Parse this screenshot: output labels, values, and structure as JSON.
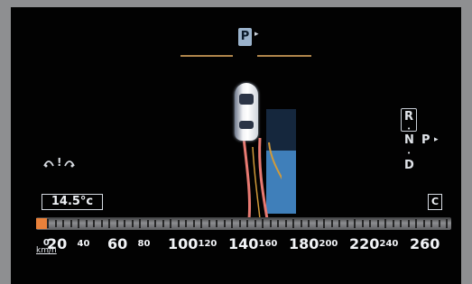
{
  "parking": {
    "badge": "P",
    "arrow": "▸"
  },
  "gear_selector": {
    "options": [
      "R",
      "N",
      "P",
      "D"
    ],
    "arrow": "▸"
  },
  "status": {
    "warning_icon_text": "⫐!⫐",
    "temperature": "14.5°c",
    "mode_badge": "C"
  },
  "speedometer": {
    "unit_top": "0",
    "unit_bottom": "km/h",
    "current_speed_kmh": 0,
    "max_speed_kmh": 260,
    "labels": [
      "20",
      "40",
      "60",
      "80",
      "100",
      "120",
      "140",
      "160",
      "180",
      "200",
      "220",
      "240",
      "260"
    ],
    "accent_color": "#e8813b"
  },
  "colors": {
    "parking_space": "#3f7fba",
    "guide_line": "#b0864c",
    "path_lines": "#e87a72"
  }
}
